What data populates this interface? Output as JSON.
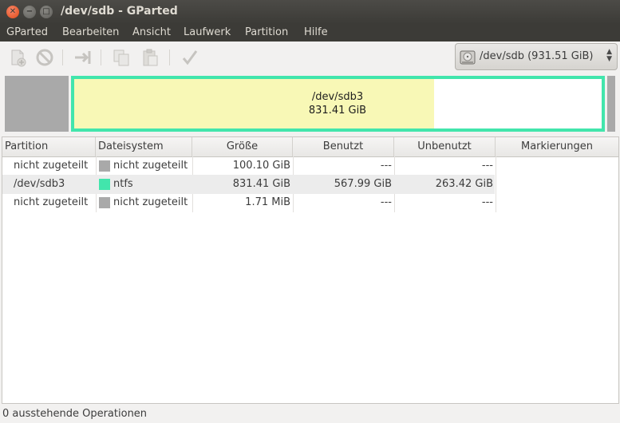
{
  "window": {
    "title": "/dev/sdb - GParted"
  },
  "menu": [
    "GParted",
    "Bearbeiten",
    "Ansicht",
    "Laufwerk",
    "Partition",
    "Hilfe"
  ],
  "toolbar": {
    "icons": [
      "new-partition-icon",
      "delete-icon",
      "resize-move-icon",
      "copy-icon",
      "paste-icon",
      "apply-icon"
    ]
  },
  "device_selector": {
    "value": "/dev/sdb  (931.51 GiB)",
    "icon": "harddisk-icon"
  },
  "disk_map": {
    "partition_name": "/dev/sdb3",
    "partition_size": "831.41 GiB",
    "used_fraction": 0.683,
    "colors": {
      "unallocated": "#a9a9a9",
      "ntfs": "#42e5ac",
      "used": "#f8f8b6",
      "free": "#ffffff"
    }
  },
  "table": {
    "columns": [
      "Partition",
      "Dateisystem",
      "Größe",
      "Benutzt",
      "Unbenutzt",
      "Markierungen"
    ],
    "rows": [
      {
        "partition": "nicht zugeteilt",
        "fs": "nicht zugeteilt",
        "fs_color": "#a9a9a9",
        "size": "100.10 GiB",
        "used": "---",
        "unused": "---",
        "flags": ""
      },
      {
        "partition": "/dev/sdb3",
        "fs": "ntfs",
        "fs_color": "#42e5ac",
        "size": "831.41 GiB",
        "used": "567.99 GiB",
        "unused": "263.42 GiB",
        "flags": ""
      },
      {
        "partition": "nicht zugeteilt",
        "fs": "nicht zugeteilt",
        "fs_color": "#a9a9a9",
        "size": "1.71 MiB",
        "used": "---",
        "unused": "---",
        "flags": ""
      }
    ]
  },
  "status": {
    "text": "0 ausstehende Operationen"
  }
}
